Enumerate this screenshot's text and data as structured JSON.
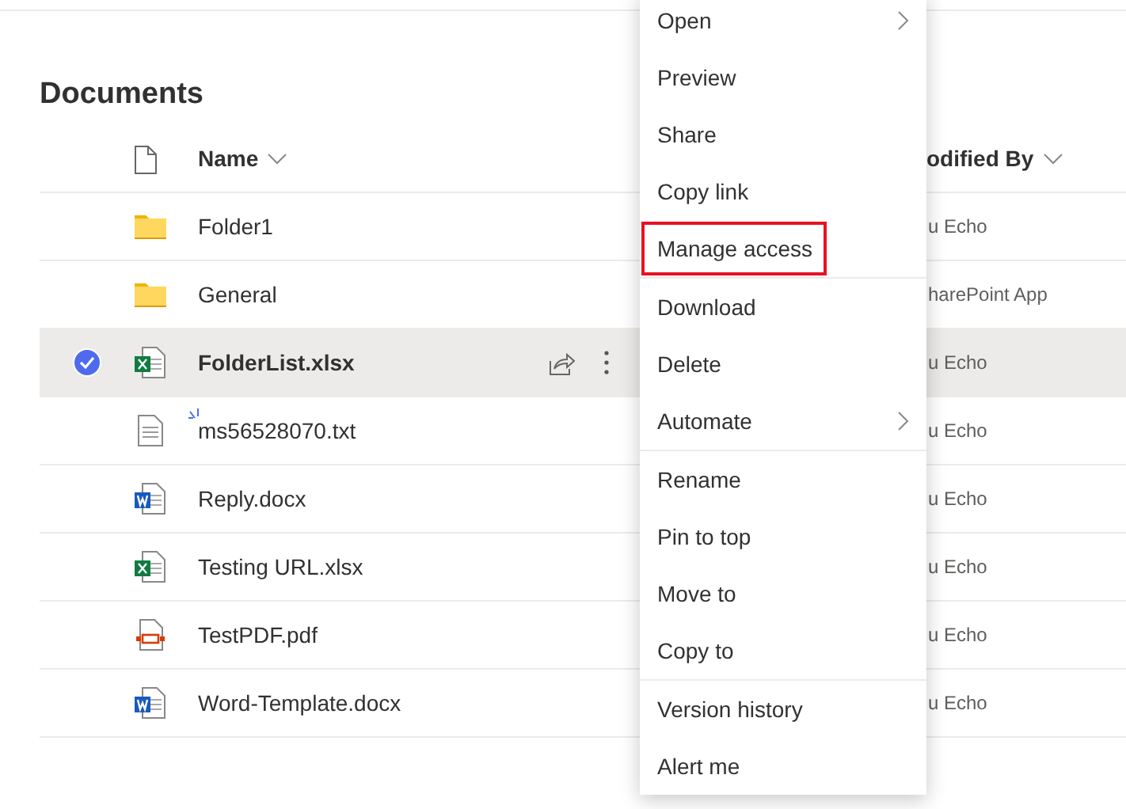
{
  "title": "Documents",
  "table": {
    "columns": [
      {
        "label": "Name"
      },
      {
        "label": "odified By"
      }
    ],
    "rows": [
      {
        "kind": "folder",
        "name": "Folder1",
        "modified_by": "u Echo",
        "selected": false,
        "loading": false
      },
      {
        "kind": "folder",
        "name": "General",
        "modified_by": "harePoint App",
        "selected": false,
        "loading": false
      },
      {
        "kind": "excel",
        "name": "FolderList.xlsx",
        "modified_by": "u Echo",
        "selected": true,
        "loading": false
      },
      {
        "kind": "text",
        "name": "ms56528070.txt",
        "modified_by": "u Echo",
        "selected": false,
        "loading": true
      },
      {
        "kind": "word",
        "name": "Reply.docx",
        "modified_by": "u Echo",
        "selected": false,
        "loading": false
      },
      {
        "kind": "excel",
        "name": "Testing URL.xlsx",
        "modified_by": "u Echo",
        "selected": false,
        "loading": false
      },
      {
        "kind": "pdf",
        "name": "TestPDF.pdf",
        "modified_by": "u Echo",
        "selected": false,
        "loading": false
      },
      {
        "kind": "word",
        "name": "Word-Template.docx",
        "modified_by": "u Echo",
        "selected": false,
        "loading": false
      }
    ]
  },
  "context_menu": {
    "groups": [
      [
        {
          "label": "Open",
          "submenu": true,
          "outlined": false
        },
        {
          "label": "Preview",
          "submenu": false,
          "outlined": false
        },
        {
          "label": "Share",
          "submenu": false,
          "outlined": false
        },
        {
          "label": "Copy link",
          "submenu": false,
          "outlined": false
        },
        {
          "label": "Manage access",
          "submenu": false,
          "outlined": true
        }
      ],
      [
        {
          "label": "Download",
          "submenu": false,
          "outlined": false
        },
        {
          "label": "Delete",
          "submenu": false,
          "outlined": false
        },
        {
          "label": "Automate",
          "submenu": true,
          "outlined": false
        }
      ],
      [
        {
          "label": "Rename",
          "submenu": false,
          "outlined": false
        },
        {
          "label": "Pin to top",
          "submenu": false,
          "outlined": false
        },
        {
          "label": "Move to",
          "submenu": false,
          "outlined": false
        },
        {
          "label": "Copy to",
          "submenu": false,
          "outlined": false
        }
      ],
      [
        {
          "label": "Version history",
          "submenu": false,
          "outlined": false
        },
        {
          "label": "Alert me",
          "submenu": false,
          "outlined": false
        }
      ]
    ]
  }
}
